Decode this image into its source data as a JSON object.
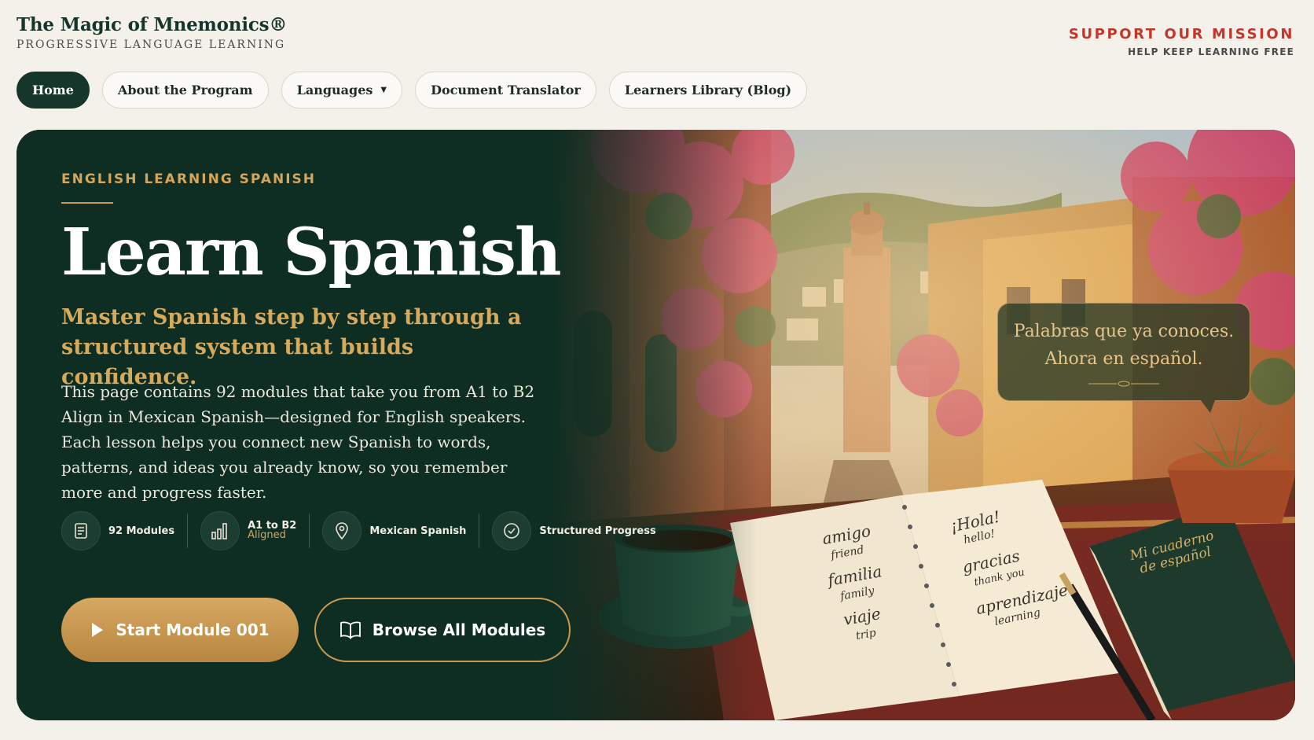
{
  "header": {
    "brand_title": "The Magic of Mnemonics®",
    "brand_subtitle": "PROGRESSIVE LANGUAGE LEARNING",
    "support_title": "SUPPORT OUR MISSION",
    "support_subtitle": "HELP KEEP LEARNING FREE"
  },
  "nav": {
    "items": [
      {
        "label": "Home",
        "active": true
      },
      {
        "label": "About the Program"
      },
      {
        "label": "Languages",
        "caret": "▼"
      },
      {
        "label": "Document Translator"
      },
      {
        "label": "Learners Library (Blog)"
      }
    ]
  },
  "hero": {
    "eyebrow": "ENGLISH LEARNING SPANISH",
    "title": "Learn Spanish",
    "subtitle": "Master Spanish step by step through a structured system that builds confidence.",
    "body": "This page contains 92 modules that take you from A1 to B2 Align in Mexican Spanish—designed for English speakers. Each lesson helps you connect new Spanish to words, patterns, and ideas you already know, so you remember more and progress faster.",
    "features": [
      {
        "icon": "document-icon",
        "label": "92 Modules"
      },
      {
        "icon": "bar-chart-icon",
        "label": "A1 to B2",
        "label2": "Aligned"
      },
      {
        "icon": "location-pin-icon",
        "label": "Mexican Spanish"
      },
      {
        "icon": "check-circle-icon",
        "label": "Structured Progress"
      }
    ],
    "primary_button": "Start Module 001",
    "secondary_button": "Browse All Modules"
  },
  "speech_bubble": {
    "line1": "Palabras que ya conoces.",
    "line2": "Ahora en español."
  },
  "notebook": {
    "left": [
      {
        "word": "amigo",
        "translation": "friend"
      },
      {
        "word": "familia",
        "translation": "family"
      },
      {
        "word": "viaje",
        "translation": "trip"
      }
    ],
    "right": [
      {
        "word": "¡Hola!",
        "translation": "hello!"
      },
      {
        "word": "gracias",
        "translation": "thank you"
      },
      {
        "word": "aprendizaje",
        "translation": "learning"
      }
    ],
    "book_title_line1": "Mi cuaderno",
    "book_title_line2": "de español"
  },
  "colors": {
    "brand_green": "#17362b",
    "hero_green": "#0f2e23",
    "gold": "#d4a55b",
    "support_red": "#c2372b"
  }
}
